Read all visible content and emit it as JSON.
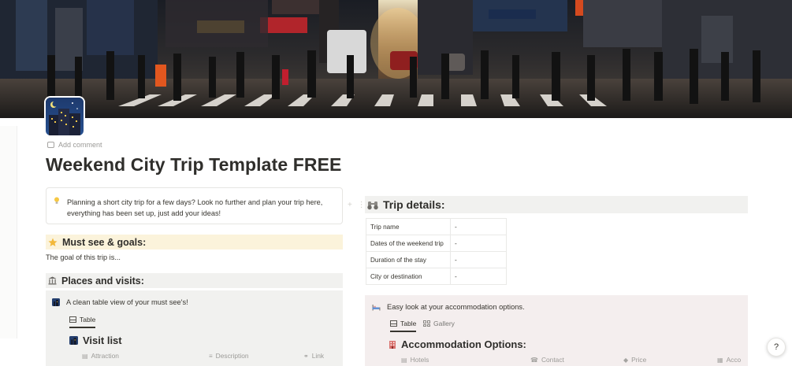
{
  "page": {
    "title": "Weekend City Trip Template FREE",
    "add_comment": "Add comment",
    "icon": "city-night-icon",
    "cover": "city-street-crosswalk-photo"
  },
  "callout": {
    "icon": "lightbulb-icon",
    "text": "Planning a short city trip for a few days? Look no further and plan your trip here, everything has been set up, just add your ideas!"
  },
  "must_see": {
    "icon": "star-icon",
    "heading": "Must see & goals:",
    "body": "The goal of this trip is..."
  },
  "places": {
    "icon": "classical-building-icon",
    "heading": "Places and visits:",
    "db_description": "A clean table view of your must see's!",
    "tab_table": "Table",
    "db_title": "Visit list",
    "columns": [
      "Attraction",
      "Description",
      "Link"
    ]
  },
  "trip_details": {
    "icon": "binoculars-icon",
    "heading": "Trip details:",
    "rows": [
      {
        "key": "Trip name",
        "value": "-"
      },
      {
        "key": "Dates of the weekend trip",
        "value": "-"
      },
      {
        "key": "Duration of the stay",
        "value": "-"
      },
      {
        "key": "City or destination",
        "value": "-"
      }
    ]
  },
  "accommodation": {
    "icon": "bed-icon",
    "description": "Easy look at your accommodation options.",
    "tab_table": "Table",
    "tab_gallery": "Gallery",
    "db_title": "Accommodation Options:",
    "columns": [
      "Hotels",
      "Contact",
      "Price",
      "Acco"
    ]
  },
  "help": {
    "label": "?"
  },
  "colors": {
    "text": "#37352f",
    "callout_yellow": "#fbf3db",
    "gray_block": "#f1f1ef",
    "red_block": "#f4eeee"
  }
}
